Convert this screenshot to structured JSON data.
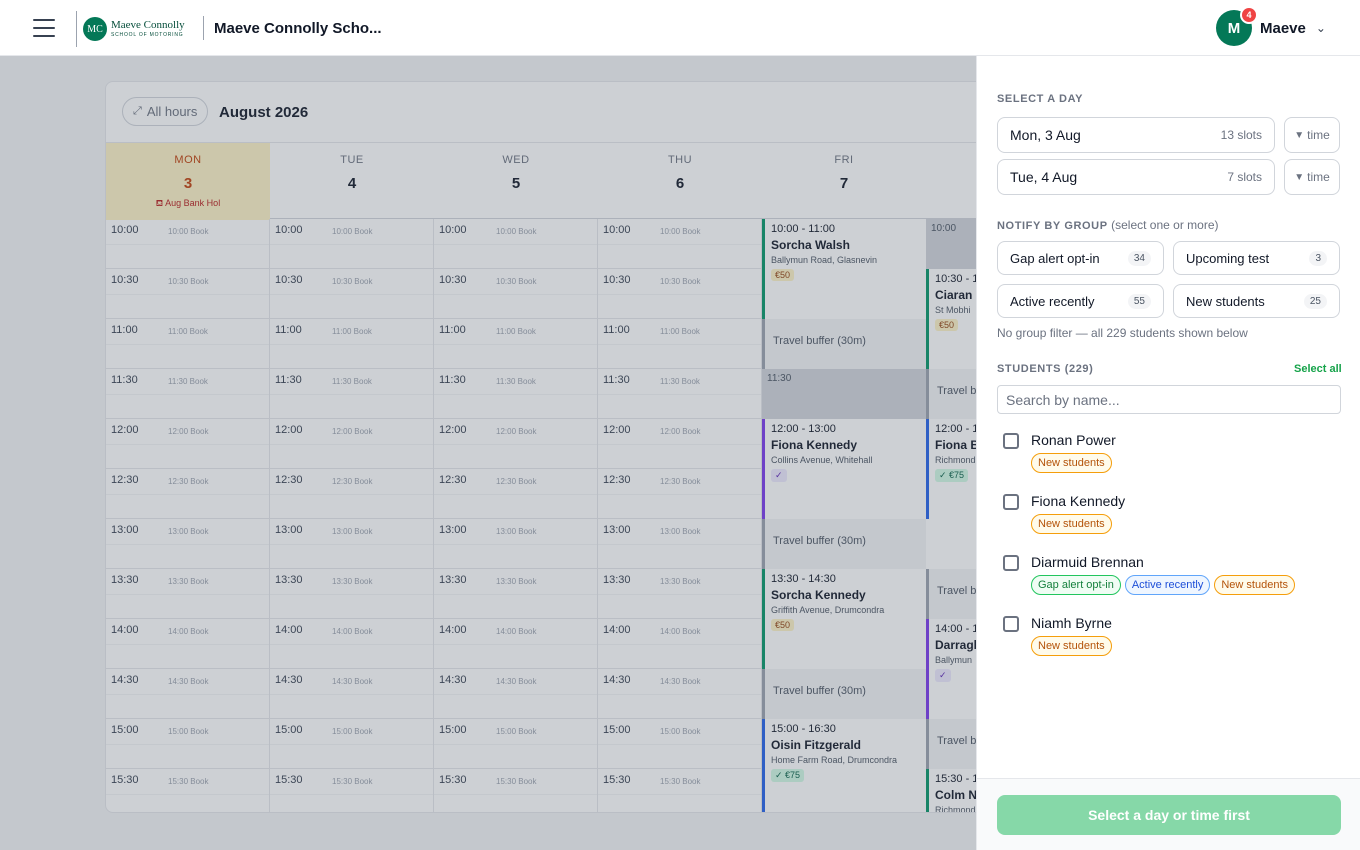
{
  "header": {
    "logo_initials": "MC",
    "logo_name": "Maeve Connolly",
    "logo_tagline": "SCHOOL OF MOTORING",
    "school_name": "Maeve Connolly Scho...",
    "user_initial": "M",
    "user_name": "Maeve",
    "notification_count": "4"
  },
  "calendar": {
    "all_hours_label": "All hours",
    "month_label": "August 2026",
    "days": [
      {
        "name": "MON",
        "date": "3",
        "note": "Aug Bank Hol",
        "today": true
      },
      {
        "name": "TUE",
        "date": "4",
        "note": ""
      },
      {
        "name": "WED",
        "date": "5",
        "note": ""
      },
      {
        "name": "THU",
        "date": "6",
        "note": ""
      },
      {
        "name": "FRI",
        "date": "7",
        "note": ""
      }
    ],
    "times": [
      "10:00",
      "10:30",
      "11:00",
      "11:30",
      "12:00",
      "12:30",
      "13:00",
      "13:30",
      "14:00",
      "14:30",
      "15:00",
      "15:30"
    ],
    "book_suffix": "Book",
    "friday_items": [
      {
        "kind": "event",
        "slot": 0,
        "span": 2,
        "time": "10:00 - 11:00",
        "name": "Sorcha Walsh",
        "address": "Ballymun Road, Glasnevin",
        "pill": "€50",
        "pill_style": "amber",
        "accent": "green"
      },
      {
        "kind": "buffer",
        "slot": 2,
        "label": "Travel buffer (30m)"
      },
      {
        "kind": "blocked",
        "slot": 3,
        "label": "11:30"
      },
      {
        "kind": "event",
        "slot": 4,
        "span": 2,
        "time": "12:00 - 13:00",
        "name": "Fiona Kennedy",
        "address": "Collins Avenue, Whitehall",
        "pill": "✓",
        "pill_style": "vio",
        "accent": "purple"
      },
      {
        "kind": "buffer",
        "slot": 6,
        "label": "Travel buffer (30m)"
      },
      {
        "kind": "event",
        "slot": 7,
        "span": 2,
        "time": "13:30 - 14:30",
        "name": "Sorcha Kennedy",
        "address": "Griffith Avenue, Drumcondra",
        "pill": "€50",
        "pill_style": "amber",
        "accent": "green"
      },
      {
        "kind": "buffer",
        "slot": 9,
        "label": "Travel buffer (30m)"
      },
      {
        "kind": "event",
        "slot": 10,
        "span": 2,
        "time": "15:00 - 16:30",
        "name": "Oisin Fitzgerald",
        "address": "Home Farm Road, Drumcondra",
        "pill": "✓ €75",
        "pill_style": "green",
        "accent": "blue"
      }
    ],
    "saturday_items": [
      {
        "kind": "blocked",
        "slot": 0,
        "label": "10:00"
      },
      {
        "kind": "event",
        "slot": 1,
        "span": 2,
        "time": "10:30 - 1",
        "name": "Ciaran R",
        "address": "St Mobhi",
        "pill": "€50",
        "pill_style": "amber",
        "accent": "green"
      },
      {
        "kind": "buffer",
        "slot": 3,
        "label": "Travel bu"
      },
      {
        "kind": "event",
        "slot": 4,
        "span": 2,
        "time": "12:00 - 1",
        "name": "Fiona B",
        "address": "Richmond",
        "pill": "✓ €75",
        "pill_style": "green",
        "accent": "blue"
      },
      {
        "kind": "buffer",
        "slot": 7,
        "label": "Travel bu"
      },
      {
        "kind": "event",
        "slot": 8,
        "span": 2,
        "time": "14:00 - 1",
        "name": "Darragh",
        "address": "Ballymun",
        "pill": "✓",
        "pill_style": "vio",
        "accent": "purple"
      },
      {
        "kind": "buffer",
        "slot": 10,
        "label": "Travel bu"
      },
      {
        "kind": "event",
        "slot": 11,
        "span": 1,
        "time": "15:30 - 1",
        "name": "Colm N",
        "address": "Richmond",
        "pill": "",
        "pill_style": "amber",
        "accent": "green"
      }
    ]
  },
  "panel": {
    "select_day_label": "SELECT A DAY",
    "day_options": [
      {
        "label": "Mon, 3 Aug",
        "slots": "13 slots",
        "time_button": "time"
      },
      {
        "label": "Tue, 4 Aug",
        "slots": "7 slots",
        "time_button": "time"
      }
    ],
    "notify_label": "NOTIFY BY GROUP",
    "notify_sub": "(select one or more)",
    "groups": [
      {
        "label": "Gap alert opt-in",
        "count": "34"
      },
      {
        "label": "Upcoming test",
        "count": "3"
      },
      {
        "label": "Active recently",
        "count": "55"
      },
      {
        "label": "New students",
        "count": "25"
      }
    ],
    "filter_note": "No group filter — all 229 students shown below",
    "students_label": "STUDENTS (229)",
    "select_all_label": "Select all",
    "search_placeholder": "Search by name...",
    "students": [
      {
        "name": "Ronan Power",
        "tags": [
          {
            "label": "New students",
            "kind": "new"
          }
        ]
      },
      {
        "name": "Fiona Kennedy",
        "tags": [
          {
            "label": "New students",
            "kind": "new"
          }
        ]
      },
      {
        "name": "Diarmuid Brennan",
        "tags": [
          {
            "label": "Gap alert opt-in",
            "kind": "gap"
          },
          {
            "label": "Active recently",
            "kind": "act"
          },
          {
            "label": "New students",
            "kind": "new"
          }
        ]
      },
      {
        "name": "Niamh Byrne",
        "tags": [
          {
            "label": "New students",
            "kind": "new"
          }
        ]
      }
    ],
    "submit_label": "Select a day or time first"
  }
}
